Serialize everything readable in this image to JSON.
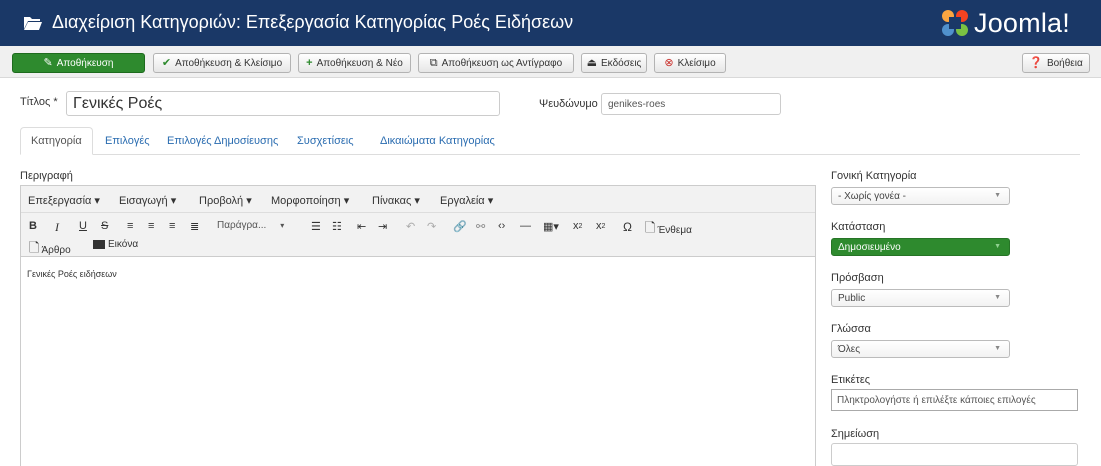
{
  "header": {
    "title": "Διαχείριση Κατηγοριών: Επεξεργασία Κατηγορίας Ροές Ειδήσεων",
    "logo_text": "Joomla!"
  },
  "toolbar": {
    "save": "Αποθήκευση",
    "save_close": "Αποθήκευση & Κλείσιμο",
    "save_new": "Αποθήκευση & Νέο",
    "save_copy": "Αποθήκευση ως Αντίγραφο",
    "versions": "Εκδόσεις",
    "close": "Κλείσιμο",
    "help": "Βοήθεια"
  },
  "form": {
    "title_label": "Τίτλος *",
    "title_value": "Γενικές Ροές",
    "alias_label": "Ψευδώνυμο",
    "alias_value": "genikes-roes"
  },
  "tabs": [
    "Κατηγορία",
    "Επιλογές",
    "Επιλογές Δημοσίευσης",
    "Συσχετίσεις",
    "Δικαιώματα Κατηγορίας"
  ],
  "editor": {
    "label": "Περιγραφή",
    "menu": [
      "Επεξεργασία ▾",
      "Εισαγωγή ▾",
      "Προβολή ▾",
      "Μορφοποίηση ▾",
      "Πίνακας ▾",
      "Εργαλεία ▾"
    ],
    "format_select": "Παράγρα...",
    "btn_insert": "Ένθεμα",
    "btn_article": "Άρθρο",
    "btn_image": "Εικόνα",
    "content": "Γενικές Ροές ειδήσεων"
  },
  "sidebar": {
    "parent_label": "Γονική Κατηγορία",
    "parent_value": "- Χωρίς γονέα -",
    "status_label": "Κατάσταση",
    "status_value": "Δημοσιευμένο",
    "access_label": "Πρόσβαση",
    "access_value": "Public",
    "language_label": "Γλώσσα",
    "language_value": "Όλες",
    "tags_label": "Ετικέτες",
    "tags_placeholder": "Πληκτρολογήστε ή επιλέξτε κάποιες επιλογές",
    "note_label": "Σημείωση",
    "note_value": ""
  }
}
